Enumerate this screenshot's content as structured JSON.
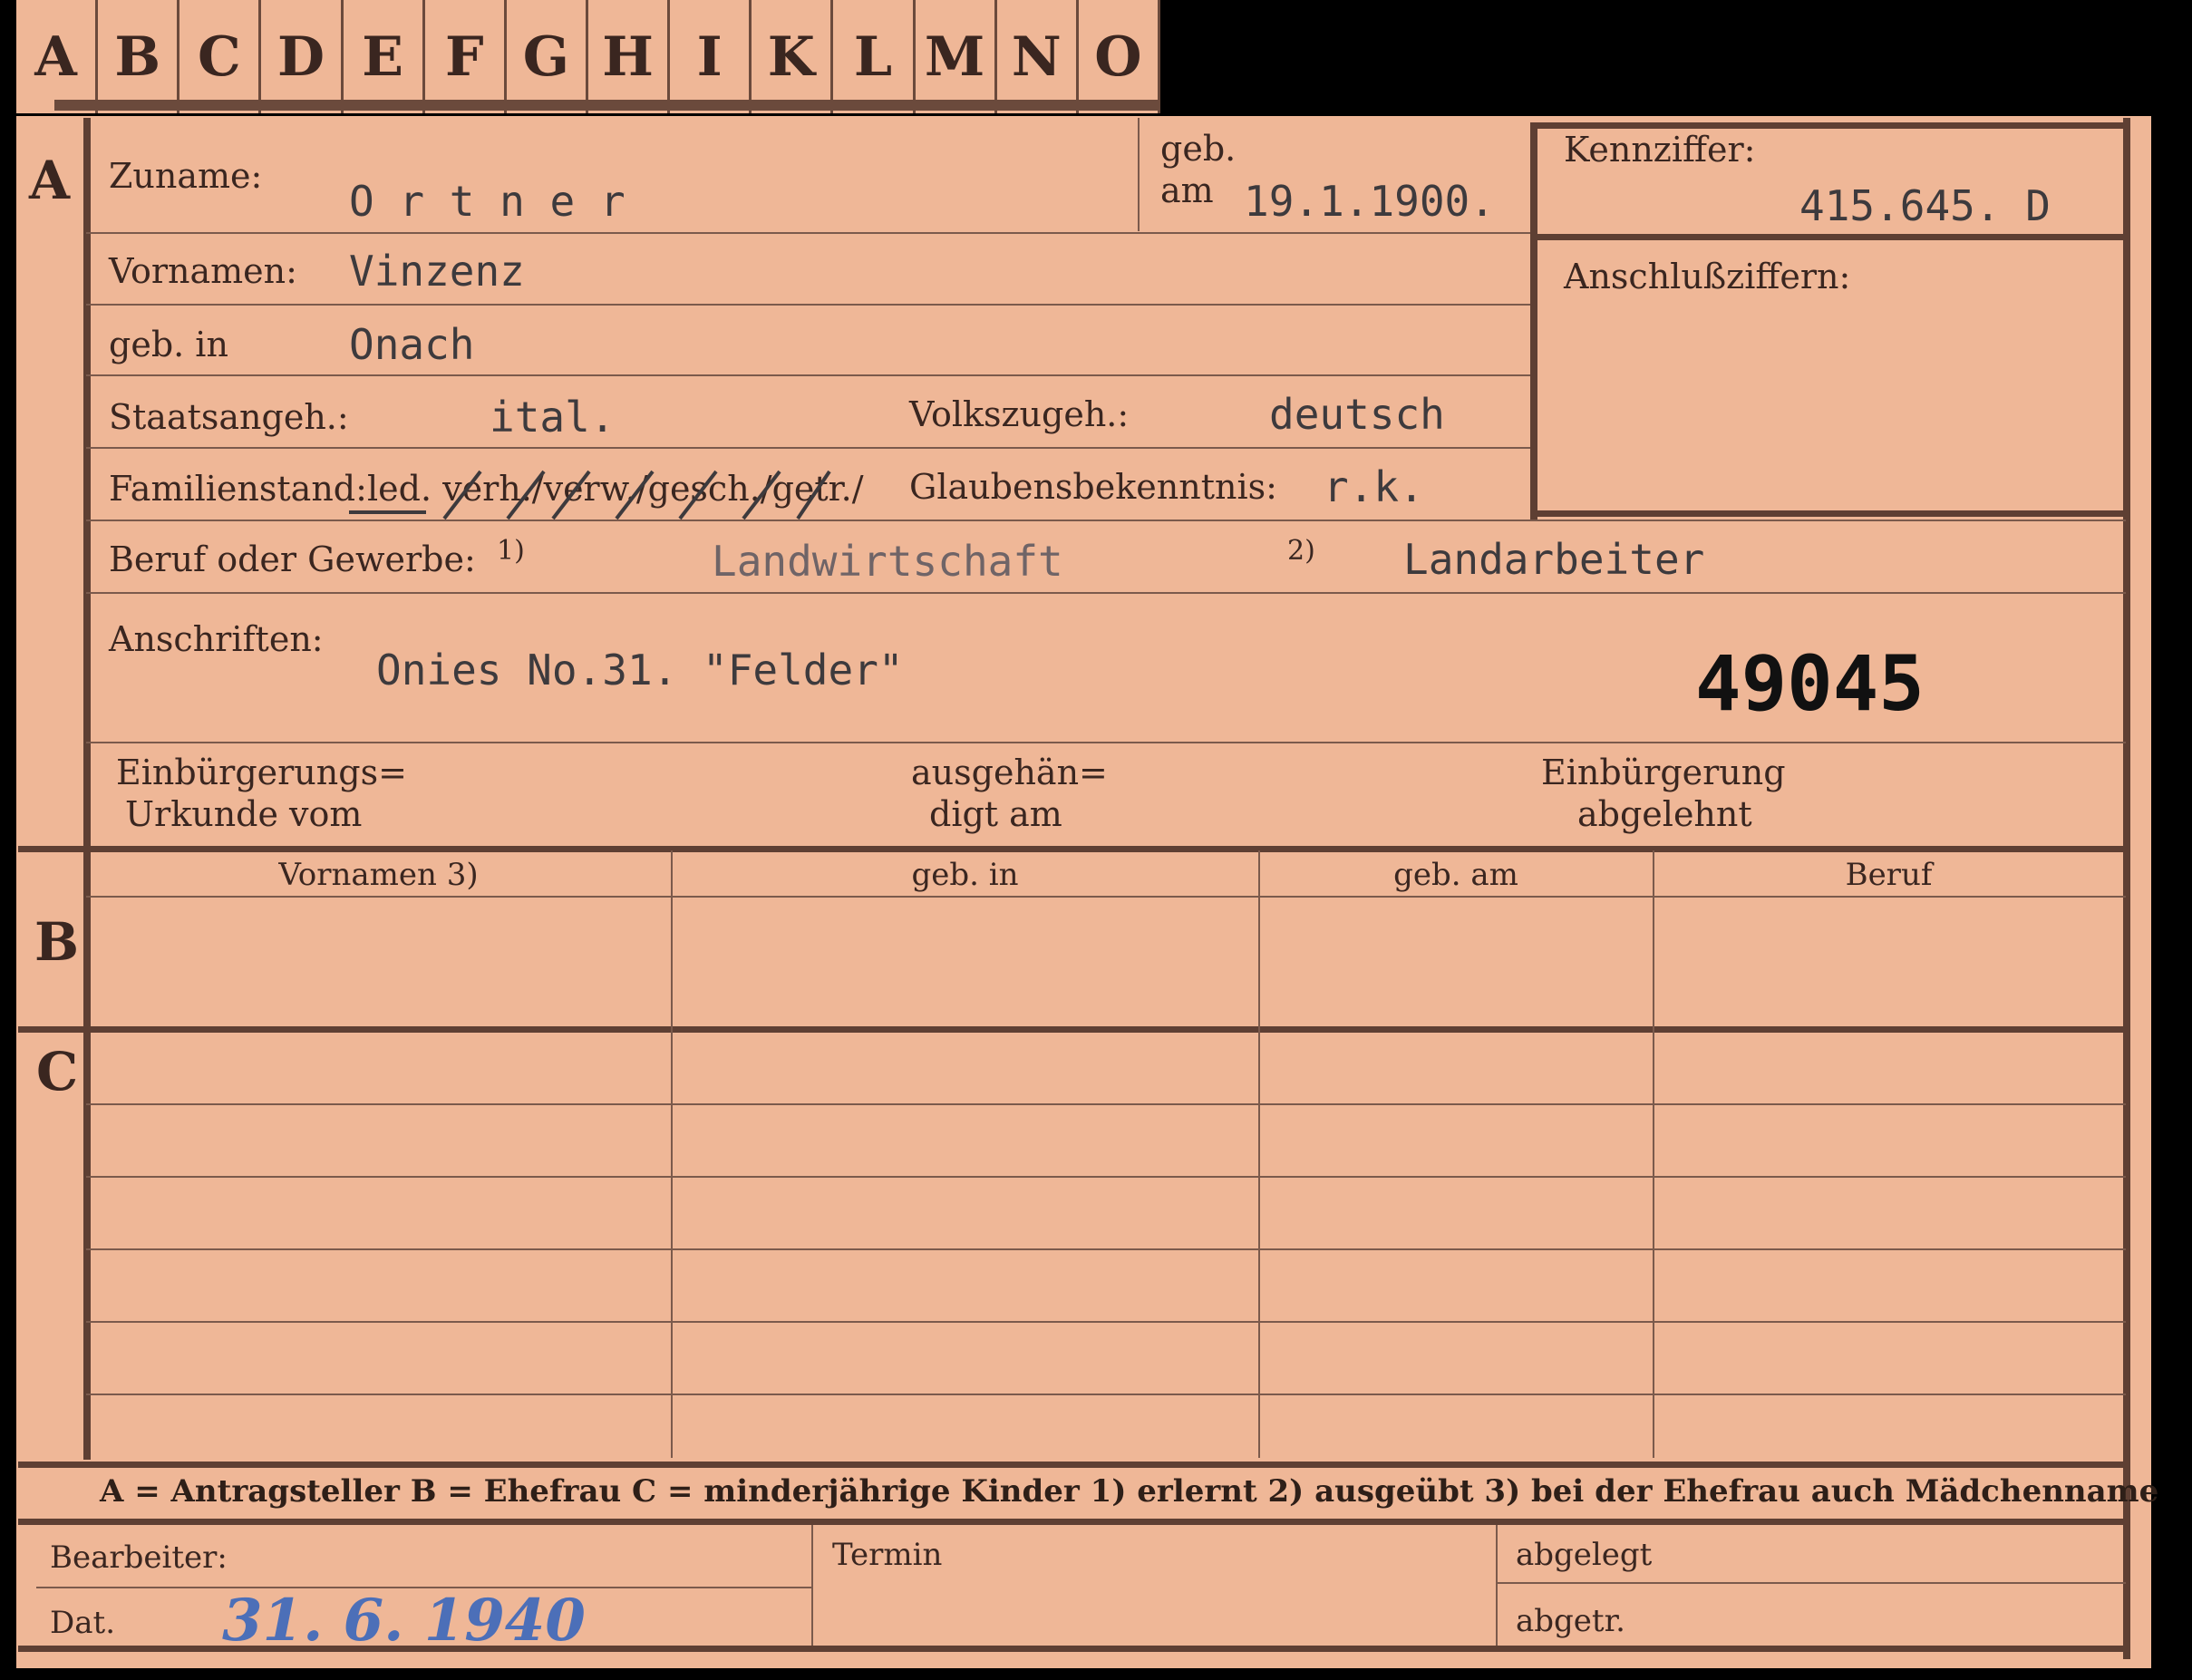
{
  "tabs": [
    "A",
    "B",
    "C",
    "D",
    "E",
    "F",
    "G",
    "H",
    "I",
    "K",
    "L",
    "M",
    "N",
    "O"
  ],
  "sections": {
    "a": "A",
    "b": "B",
    "c": "C"
  },
  "labels": {
    "zuname": "Zuname:",
    "geb": "geb.",
    "am": "am",
    "kennziffer": "Kennziffer:",
    "anschlussziffern": "Anschlußziffern:",
    "vornamen": "Vornamen:",
    "geb_in": "geb. in",
    "staatsangeh": "Staatsangeh.:",
    "volkszugeh": "Volkszugeh.:",
    "familienstand": "Familienstand:",
    "familienstand_options": "led. verh./verw./gesch./getr./",
    "glaubensbekenntnis": "Glaubensbekenntnis:",
    "beruf": "Beruf oder Gewerbe:",
    "fn1": "1)",
    "fn2": "2)",
    "anschriften": "Anschriften:",
    "einbuergerungs_1": "Einbürgerungs=",
    "einbuergerungs_2": "Urkunde vom",
    "ausgehaen_1": "ausgehän=",
    "ausgehaen_2": "digt am",
    "abgelehnt_1": "Einbürgerung",
    "abgelehnt_2": "abgelehnt",
    "bearbeiter": "Bearbeiter:",
    "dat": "Dat.",
    "termin": "Termin",
    "abgelegt": "abgelegt",
    "abgetr": "abgetr."
  },
  "values": {
    "zuname": "O r t n e r",
    "geb_am": "19.1.1900.",
    "kennziffer": "415.645.  D",
    "vornamen": "Vinzenz",
    "geb_in": "Onach",
    "staatsangeh": "ital.",
    "volkszugeh": "deutsch",
    "glaubensbekenntnis": "r.k.",
    "beruf_erlernt": "Landwirtschaft",
    "beruf_ausgeuebt": "Landarbeiter",
    "anschrift": "Onies No.31.  \"Felder\"",
    "stamp_number": "49045",
    "dat": "31. 6. 1940"
  },
  "columns": [
    "Vornamen 3)",
    "geb. in",
    "geb. am",
    "Beruf"
  ],
  "legend": "A = Antragsteller   B = Ehefrau   C = minderjährige Kinder   1) erlernt   2) ausgeübt   3) bei der Ehefrau auch Mädchenname"
}
